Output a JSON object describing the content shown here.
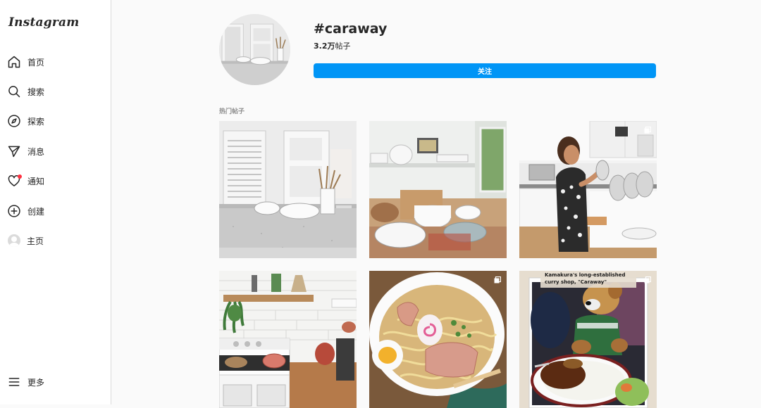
{
  "app": {
    "logo": "Instagram"
  },
  "sidebar": {
    "items": [
      {
        "label": "首页",
        "icon": "home-icon"
      },
      {
        "label": "搜索",
        "icon": "search-icon"
      },
      {
        "label": "探索",
        "icon": "compass-icon"
      },
      {
        "label": "消息",
        "icon": "send-icon"
      },
      {
        "label": "通知",
        "icon": "heart-icon"
      },
      {
        "label": "创建",
        "icon": "plus-square-icon"
      },
      {
        "label": "主页",
        "icon": "avatar"
      }
    ],
    "more_label": "更多"
  },
  "hashtag": {
    "title": "#caraway",
    "count_number": "3.2万",
    "count_suffix": "帖子",
    "follow_label": "关注"
  },
  "section_label": "热门帖子",
  "posts": [
    {
      "id": "kitchen-white-counter",
      "multi": false
    },
    {
      "id": "open-shelf-cookware",
      "multi": false
    },
    {
      "id": "woman-kitchen-pans",
      "multi": true
    },
    {
      "id": "stove-tiled-wall",
      "multi": false
    },
    {
      "id": "ramen-bowl",
      "multi": true
    },
    {
      "id": "curry-shop-bear",
      "multi": true
    }
  ],
  "post_captions": {
    "curry_shop_text": "Kamakura's long-established curry shop, \"Caraway\""
  },
  "colors": {
    "accent": "#0095f6",
    "notification": "#ff3040"
  }
}
